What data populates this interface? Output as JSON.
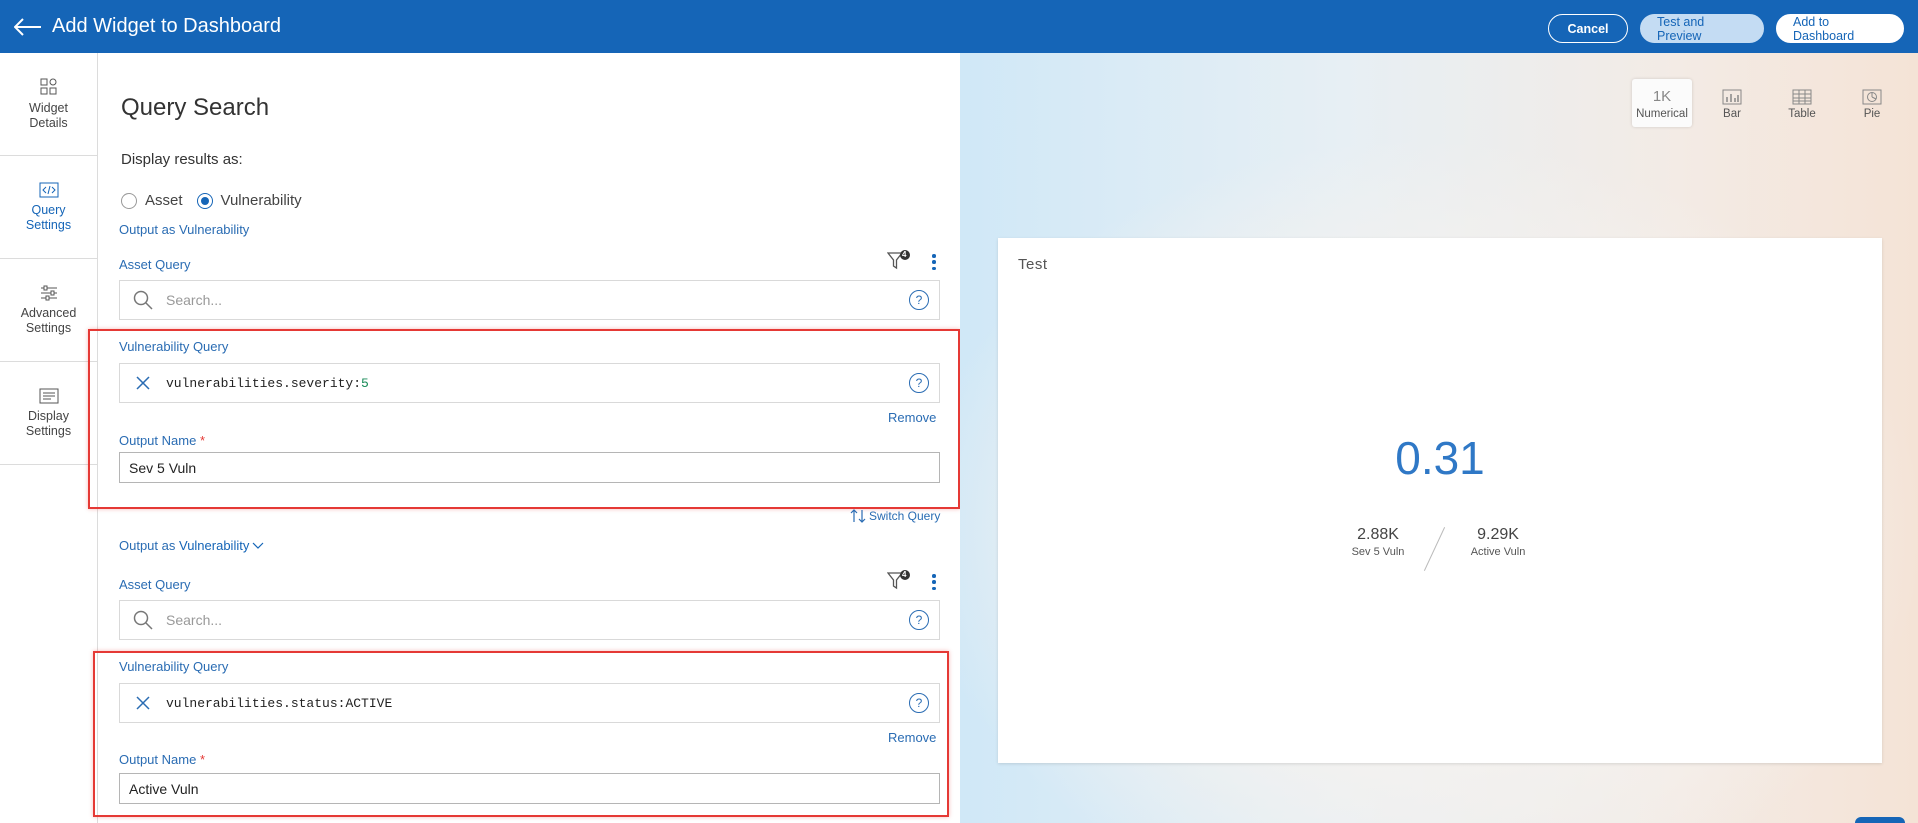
{
  "header": {
    "title": "Add Widget to Dashboard",
    "cancel_label": "Cancel",
    "test_label": "Test and Preview",
    "add_label": "Add to Dashboard"
  },
  "sidebar": {
    "items": [
      {
        "label": "Widget\nDetails",
        "icon": "widget-icon",
        "active": false
      },
      {
        "label": "Query\nSettings",
        "icon": "code-icon",
        "active": true
      },
      {
        "label": "Advanced\nSettings",
        "icon": "sliders-icon",
        "active": false
      },
      {
        "label": "Display\nSettings",
        "icon": "display-icon",
        "active": false
      }
    ]
  },
  "query": {
    "heading": "Query Search",
    "display_label": "Display results as:",
    "radio_asset": "Asset",
    "radio_vuln": "Vulnerability",
    "selected": "Vulnerability",
    "block1": {
      "output_as": "Output as Vulnerability",
      "asset_label": "Asset Query",
      "filter_count": "4",
      "search_placeholder": "Search...",
      "vuln_label": "Vulnerability Query",
      "vuln_key": "vulnerabilities.severity:",
      "vuln_value": "5",
      "remove_label": "Remove",
      "output_name_label": "Output Name",
      "required_mark": "*",
      "output_name_value": "Sev 5 Vuln"
    },
    "switch_label": "Switch Query",
    "block2": {
      "output_as_prefix": "Output as",
      "output_as_value": "Vulnerability",
      "asset_label": "Asset Query",
      "filter_count": "4",
      "search_placeholder": "Search...",
      "vuln_label": "Vulnerability Query",
      "vuln_key": "vulnerabilities.status:",
      "vuln_value": "ACTIVE",
      "remove_label": "Remove",
      "output_name_label": "Output Name",
      "required_mark": "*",
      "output_name_value": "Active Vuln"
    }
  },
  "preview": {
    "chart_types": [
      {
        "label": "Numerical",
        "glyph": "1K",
        "active": true
      },
      {
        "label": "Bar",
        "icon": "bar-chart-icon"
      },
      {
        "label": "Table",
        "icon": "table-icon"
      },
      {
        "label": "Pie",
        "icon": "pie-chart-icon"
      }
    ],
    "card_title": "Test",
    "ratio_value": "0.31",
    "left_stat_value": "2.88K",
    "left_stat_label": "Sev 5 Vuln",
    "right_stat_value": "9.29K",
    "right_stat_label": "Active Vuln"
  },
  "colors": {
    "brand": "#1565b7",
    "highlight": "#e53935",
    "value_green": "#178a57"
  }
}
